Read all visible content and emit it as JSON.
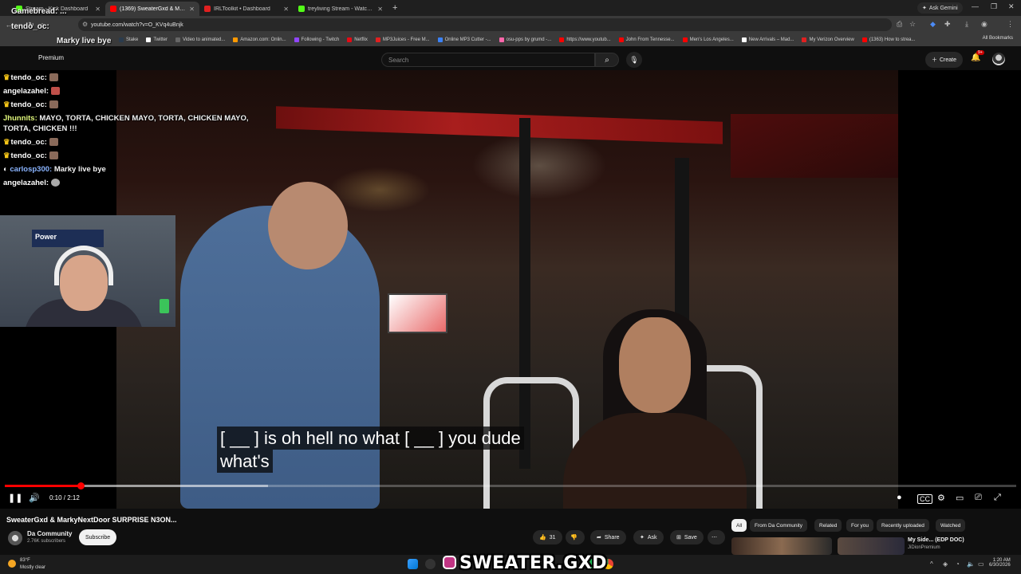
{
  "browser": {
    "tabs": [
      {
        "label": "Stream - Kick Dashboard",
        "color": "#53fc18",
        "active": false
      },
      {
        "label": "(1369) SweaterGxd & Marl...",
        "color": "#ff0000",
        "active": true
      },
      {
        "label": "IRLToolkit • Dashboard",
        "color": "#e02020",
        "active": false
      },
      {
        "label": "treyliving Stream - Watch Live",
        "color": "#53fc18",
        "active": false
      }
    ],
    "new_tab": "+",
    "ask_gemini": "Ask Gemini",
    "url": "youtube.com/watch?v=O_KVq4uBnjk",
    "bookmarks": [
      {
        "label": "Stake",
        "color": "#2a3b4d"
      },
      {
        "label": "Twitter",
        "color": "#ffffff"
      },
      {
        "label": "Video to animated...",
        "color": "#666666"
      },
      {
        "label": "Amazon.com: Onlin...",
        "color": "#ff9900"
      },
      {
        "label": "Following - Twitch",
        "color": "#9146ff"
      },
      {
        "label": "Netflix",
        "color": "#e50914"
      },
      {
        "label": "MP3Juices - Free M...",
        "color": "#e02020"
      },
      {
        "label": "Online MP3 Cutter -...",
        "color": "#3b82f6"
      },
      {
        "label": "osu-pps by grumd -...",
        "color": "#ff66aa"
      },
      {
        "label": "https://www.youtub...",
        "color": "#ff0000"
      },
      {
        "label": "John From Tennesse...",
        "color": "#ff0000"
      },
      {
        "label": "Men's Los Angeles...",
        "color": "#ff0000"
      },
      {
        "label": "New Arrivals – Mad...",
        "color": "#ffffff"
      },
      {
        "label": "My Verizon Overview",
        "color": "#e02020"
      },
      {
        "label": "(1363) How to strea...",
        "color": "#ff0000"
      }
    ],
    "all_bookmarks": "All Bookmarks"
  },
  "youtube": {
    "premium_label": "Premium",
    "search_placeholder": "Search",
    "create_label": "Create",
    "notification_count": "9+"
  },
  "chat": [
    {
      "user": "tendo_oc:",
      "msg": "",
      "crown": true,
      "style": "white"
    },
    {
      "user": "angelazahel:",
      "msg": "",
      "crown": false,
      "style": "white"
    },
    {
      "user": "tendo_oc:",
      "msg": "",
      "crown": true,
      "style": "white"
    },
    {
      "user": "Jhunnits:",
      "msg": "MAYO, TORTA, CHICKEN MAYO, TORTA, CHICKEN MAYO, TORTA, CHICKEN !!!",
      "crown": false,
      "style": "green"
    },
    {
      "user": "tendo_oc:",
      "msg": "",
      "crown": true,
      "style": "white"
    },
    {
      "user": "tendo_oc:",
      "msg": "",
      "crown": true,
      "style": "white"
    },
    {
      "user": "carlosp300:",
      "msg": "Marky live bye",
      "crown": false,
      "style": "blue"
    },
    {
      "user": "angelazahel:",
      "msg": "",
      "crown": false,
      "style": "white"
    }
  ],
  "overlay_top": {
    "gamebread": "Gamebread: ...",
    "tendo": "tendo_oc:",
    "marky": "Marky live bye"
  },
  "webcam": {
    "sign_text": "Power"
  },
  "subtitle": {
    "line1": "[ __ ] is oh hell no what [ __ ] you dude",
    "line2": "what's"
  },
  "player": {
    "current_time": "0:10",
    "duration": "2:12",
    "timecode": "0:10 / 2:12",
    "played_fraction": 0.075,
    "buffered_fraction": 0.26
  },
  "video": {
    "title": "SweaterGxd & MarkyNextDoor SURPRISE N3ON...",
    "channel": "Da Community",
    "subscribers": "2.76K subscribers",
    "subscribe_label": "Subscribe",
    "likes": "31",
    "share_label": "Share",
    "ask_label": "Ask",
    "save_label": "Save"
  },
  "chips": [
    {
      "label": "All",
      "active": true
    },
    {
      "label": "From Da Community",
      "active": false
    },
    {
      "label": "Related",
      "active": false
    },
    {
      "label": "For you",
      "active": false
    },
    {
      "label": "Recently uploaded",
      "active": false
    },
    {
      "label": "Watched",
      "active": false
    }
  ],
  "recommended": {
    "title": "My Side... (EDP DOC)",
    "channel": "JiDionPremium"
  },
  "taskbar": {
    "temperature": "83°F",
    "weather": "Mostly clear",
    "time": "1:20 AM",
    "date": "6/30/2026",
    "brand_text": "SWEATER.GXD"
  }
}
